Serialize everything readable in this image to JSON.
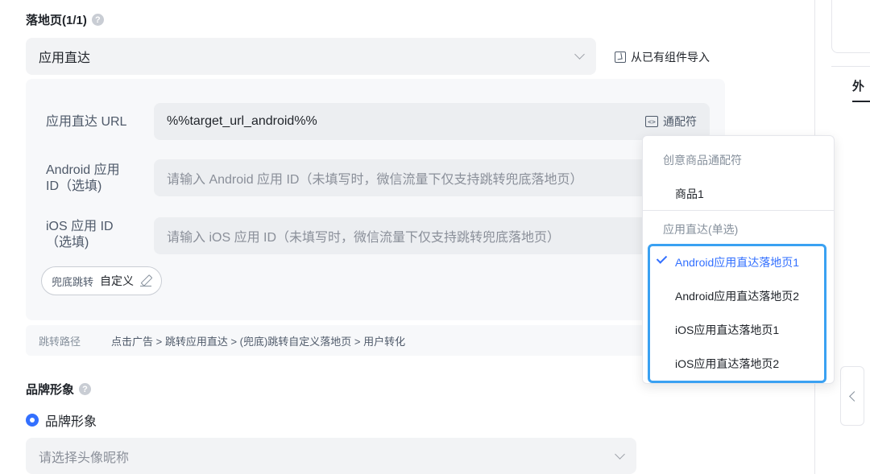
{
  "landing": {
    "title": "落地页(1/1)",
    "help": "?",
    "type_select": "应用直达",
    "import_label": "从已有组件导入"
  },
  "app_direct": {
    "url_label": "应用直达 URL",
    "url_value": "%%target_url_android%%",
    "wildcard_label": "通配符",
    "wildcard_icon_text": "<>",
    "android_label_1": "Android 应用",
    "android_label_2": "ID（选填)",
    "android_placeholder": "请输入 Android 应用 ID（未填写时，微信流量下仅支持跳转兜底落地页）",
    "ios_label_1": "iOS 应用 ID",
    "ios_label_2": "（选填)",
    "ios_placeholder": "请输入 iOS 应用 ID（未填写时，微信流量下仅支持跳转兜底落地页）",
    "fallback_key": "兜底跳转",
    "fallback_value": "自定义"
  },
  "path": {
    "label": "跳转路径",
    "value": "点击广告 > 跳转应用直达 > (兜底)跳转自定义落地页 > 用户转化"
  },
  "brand": {
    "title": "品牌形象",
    "help": "?",
    "radio_label": "品牌形象",
    "avatar_placeholder": "请选择头像昵称"
  },
  "dropdown": {
    "group1": "创意商品通配符",
    "group1_items": [
      "商品1"
    ],
    "group2": "应用直达(单选)",
    "group2_items": [
      "Android应用直达落地页1",
      "Android应用直达落地页2",
      "iOS应用直达落地页1",
      "iOS应用直达落地页2"
    ],
    "selected_index": 0
  },
  "side": {
    "tab_partial": "外"
  },
  "colors": {
    "accent": "#3370ff",
    "focus_ring": "#3aa1f2"
  }
}
